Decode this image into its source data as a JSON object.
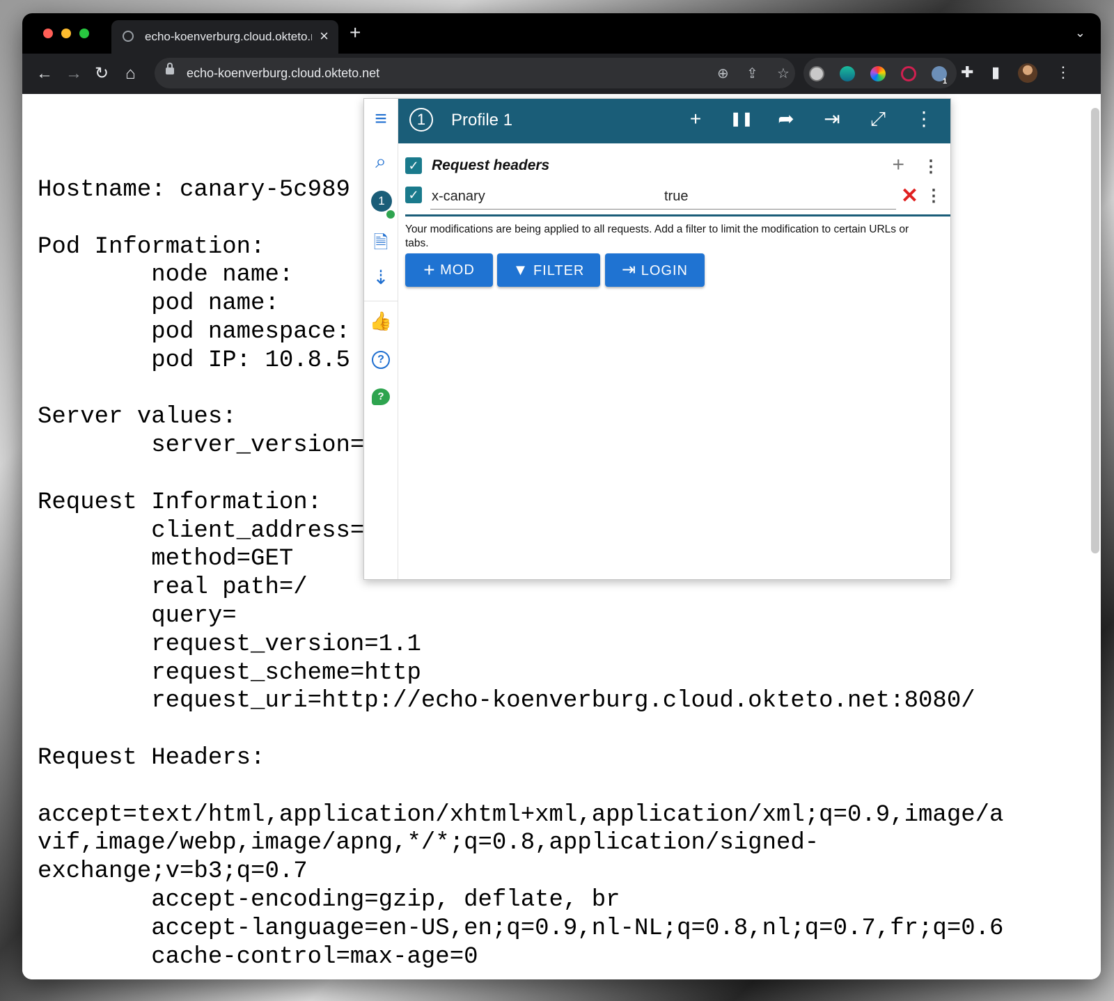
{
  "browser": {
    "tab_title": "echo-koenverburg.cloud.okteto.net",
    "tab_close": "×",
    "new_tab": "+",
    "tab_menu": "⌄",
    "url": "echo-koenverburg.cloud.okteto.net",
    "nav": {
      "back": "←",
      "forward": "→",
      "reload": "↻",
      "home": "⌂"
    },
    "toolbar_icons": {
      "zoom": "⊕",
      "share": "⇪",
      "star": "☆",
      "extensions": "✚",
      "sidepanel": "▮",
      "menu": "⋮"
    },
    "extension_badge": "1"
  },
  "page": {
    "lines": [
      "Hostname: canary-5c989",
      "",
      "Pod Information:",
      "        node name:",
      "        pod name:",
      "        pod namespace:",
      "        pod IP: 10.8.5",
      "",
      "Server values:",
      "        server_version=",
      "",
      "Request Information:",
      "        client_address=",
      "        method=GET",
      "        real path=/",
      "        query=",
      "        request_version=1.1",
      "        request_scheme=http",
      "        request_uri=http://echo-koenverburg.cloud.okteto.net:8080/",
      "",
      "Request Headers:",
      "",
      "accept=text/html,application/xhtml+xml,application/xml;q=0.9,image/a",
      "vif,image/webp,image/apng,*/*;q=0.8,application/signed-",
      "exchange;v=b3;q=0.7",
      "        accept-encoding=gzip, deflate, br",
      "        accept-language=en-US,en;q=0.9,nl-NL;q=0.8,nl;q=0.7,fr;q=0.6",
      "        cache-control=max-age=0"
    ]
  },
  "popup": {
    "profile_number": "1",
    "profile_name": "Profile 1",
    "header_icons": {
      "add": "+",
      "pause": "❚❚",
      "share": "➦",
      "login": "⇥",
      "expand": "⤢",
      "more": "⋮"
    },
    "rail": {
      "menu": "≡",
      "search": "⌕",
      "profile_badge": "1",
      "add_file": "🗎",
      "sort": "⇣",
      "like": "👍",
      "help": "?",
      "feedback": "?"
    },
    "section_title": "Request headers",
    "section_add": "+",
    "header_name": "x-canary",
    "header_value": "true",
    "remove": "✕",
    "more": "⋮",
    "note": "Your modifications are being applied to all requests. Add a filter to limit the modification to certain URLs or tabs.",
    "buttons": {
      "mod": "MOD",
      "filter": "FILTER",
      "login": "LOGIN"
    },
    "check": "✓"
  },
  "colors": {
    "header": "#1a5d78",
    "button": "#1f73d2",
    "remove": "#e02020",
    "rail_icon": "#1f6fd0"
  }
}
